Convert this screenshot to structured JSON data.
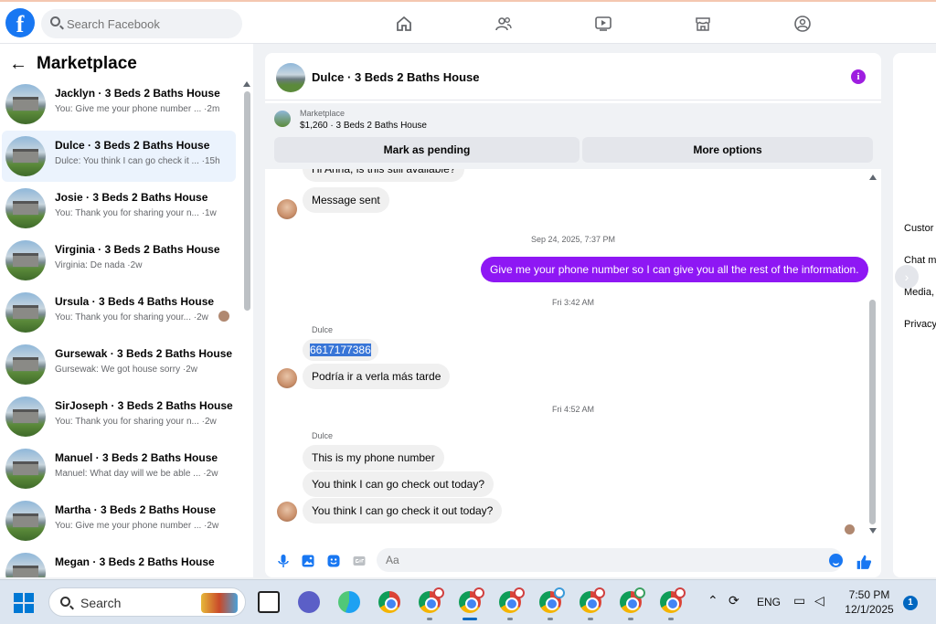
{
  "topbar": {
    "logo_letter": "f",
    "search_placeholder": "Search Facebook",
    "nav_icons": [
      "home-icon",
      "friends-icon",
      "video-icon",
      "marketplace-icon",
      "groups-icon"
    ]
  },
  "sidebar": {
    "back_label": "←",
    "title": "Marketplace",
    "conversations": [
      {
        "name": "Jacklyn · 3 Beds 2 Baths House",
        "preview": "You: Give me your phone number ... ·2m"
      },
      {
        "name": "Dulce · 3 Beds 2 Baths House",
        "preview": "Dulce: You think I can go check it ... ·15h"
      },
      {
        "name": "Josie · 3 Beds 2 Baths House",
        "preview": "You: Thank you for sharing your n... ·1w"
      },
      {
        "name": "Virginia · 3 Beds 2 Baths House",
        "preview": "Virginia: De nada ·2w"
      },
      {
        "name": "Ursula · 3 Beds 4 Baths House",
        "preview": "You: Thank you for sharing your... ·2w"
      },
      {
        "name": "Gursewak · 3 Beds 2 Baths House",
        "preview": "Gursewak: We got house sorry ·2w"
      },
      {
        "name": "SirJoseph · 3 Beds 2 Baths House",
        "preview": "You: Thank you for sharing your n... ·2w"
      },
      {
        "name": "Manuel · 3 Beds 2 Baths House",
        "preview": "Manuel: What day will we be able ... ·2w"
      },
      {
        "name": "Martha · 3 Beds 2 Baths House",
        "preview": "You: Give me your phone number ... ·2w"
      },
      {
        "name": "Megan · 3 Beds 2 Baths House",
        "preview": ""
      }
    ]
  },
  "chat": {
    "title": "Dulce · 3 Beds 2 Baths House",
    "info_glyph": "i",
    "listing_source": "Marketplace",
    "listing_price": "$1,260 · 3 Beds 2 Baths House",
    "mark_pending_label": "Mark as pending",
    "more_options_label": "More options",
    "messages": {
      "top_cut": "Hi Anna, is this still available?",
      "msg_sent": "Message sent",
      "stamp_1": "Sep 24, 2025, 7:37 PM",
      "outgoing_1": "Give me your phone number so I can give you all the rest of the information.",
      "stamp_2": "Fri 3:42 AM",
      "sender_1": "Dulce",
      "phone": "6617177386",
      "reply_1": "Podría ir a verla más tarde",
      "stamp_3": "Fri 4:52 AM",
      "sender_2": "Dulce",
      "reply_2": "This is my phone number",
      "reply_3": "You think I can go check out today?",
      "reply_4": "You think I can go check it out today?"
    },
    "composer_placeholder": "Aa"
  },
  "right_panel": {
    "items": [
      "Custor",
      "Chat m",
      "Media,",
      "Privacy"
    ],
    "next_glyph": "›"
  },
  "taskbar": {
    "search_label": "Search",
    "tray_lang": "ENG",
    "time": "7:50 PM",
    "date": "12/1/2025",
    "notification_count": "1"
  }
}
